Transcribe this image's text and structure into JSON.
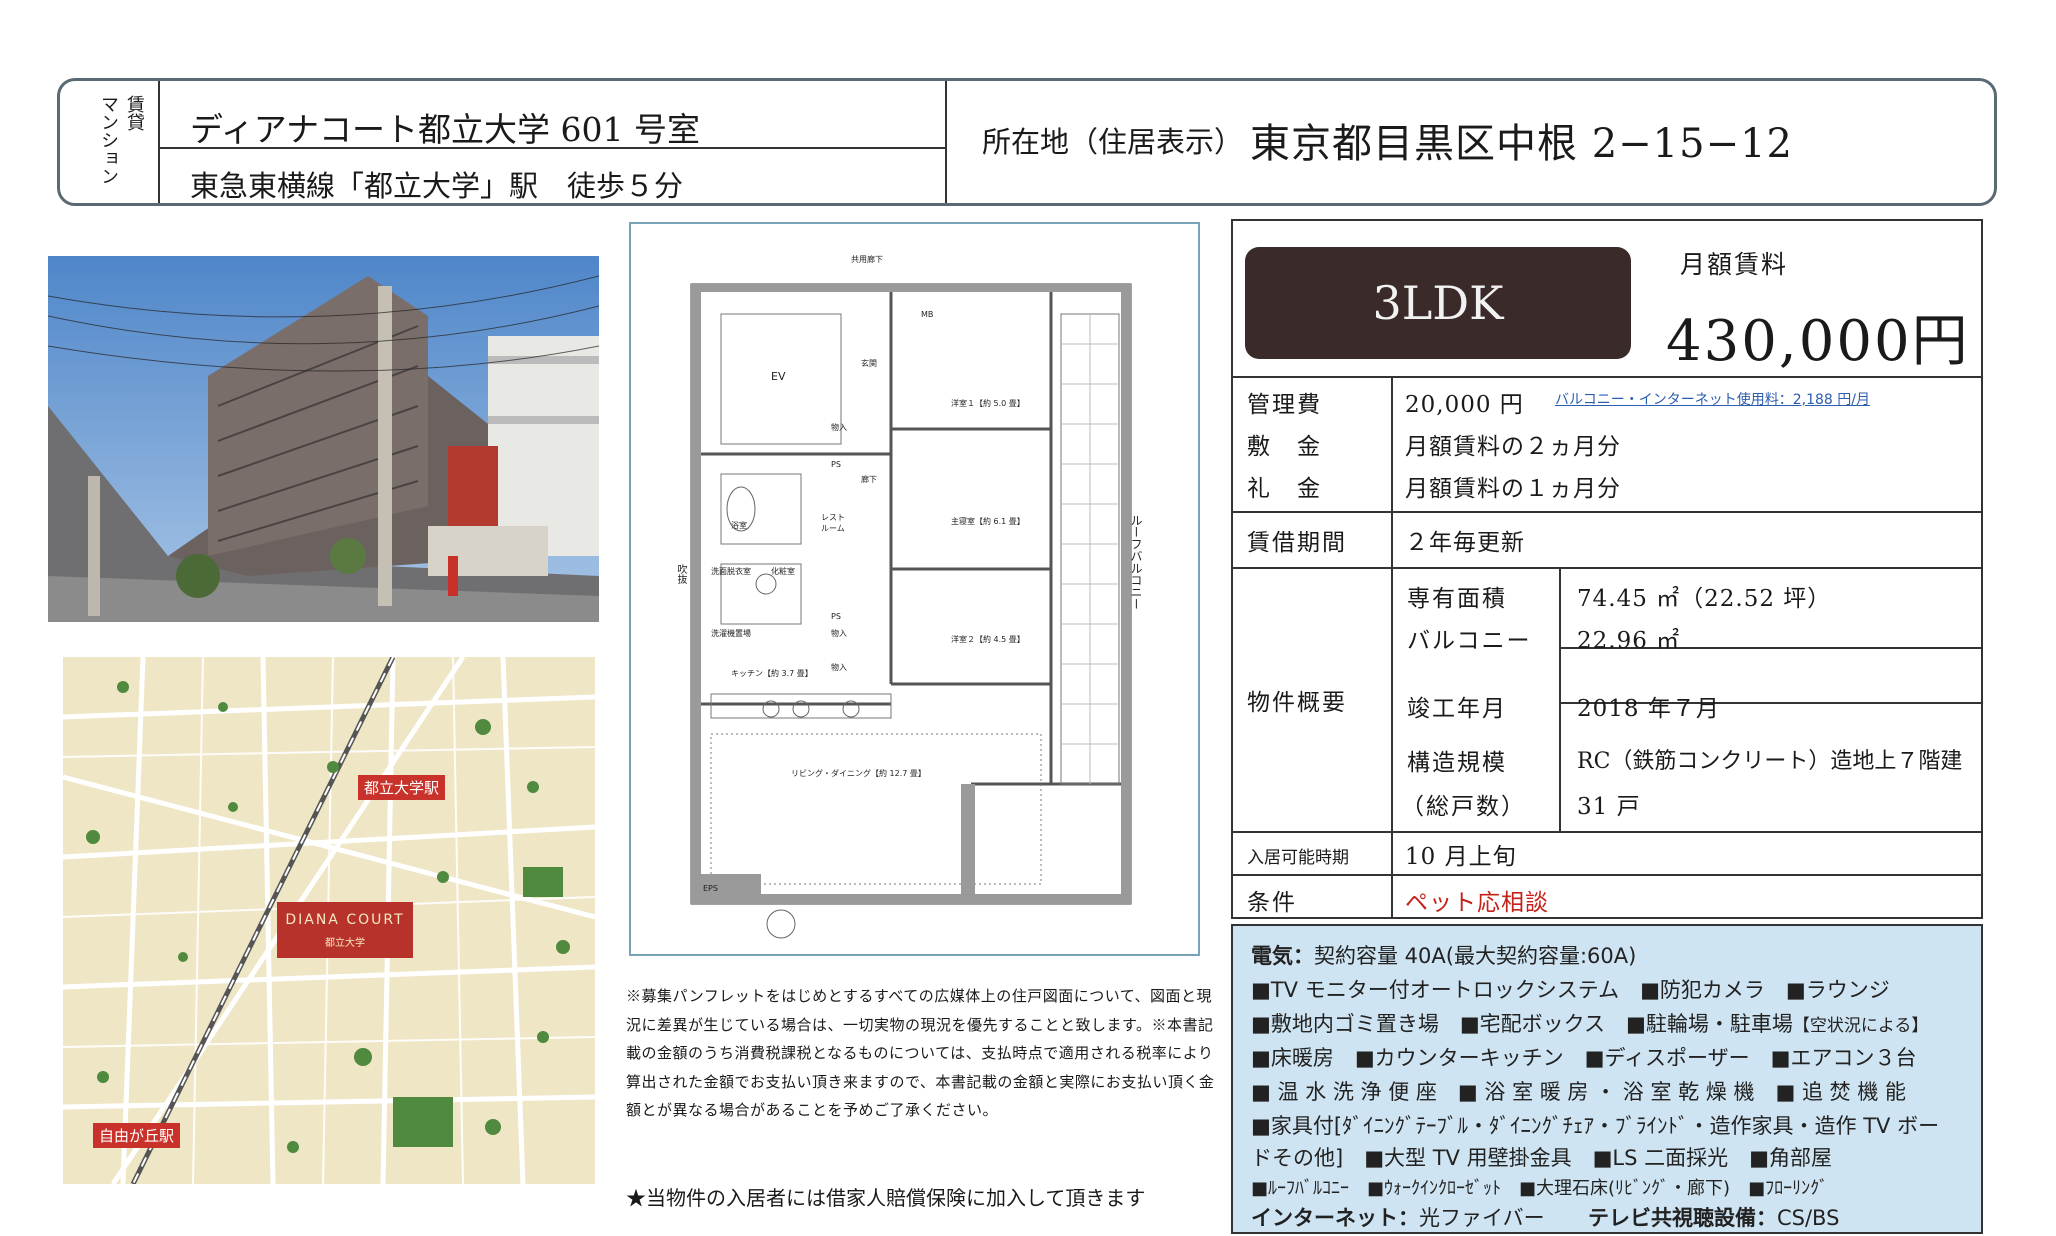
{
  "header": {
    "category": [
      "賃貸",
      "マンション"
    ],
    "building_name": "ディアナコート都立大学 601 号室",
    "access": "東急東横線「都立大学」駅　徒歩５分",
    "address_label": "所在地（住居表示）",
    "address": "東京都目黒区中根 2−15−12"
  },
  "map": {
    "station_top": "都立大学駅",
    "station_bottom": "自由が丘駅",
    "building_label": "DIANA COURT",
    "building_sublabel": "都立大学"
  },
  "plan": {
    "corridor": "共用廊下",
    "ev": "EV",
    "mb": "MB",
    "ps1": "PS",
    "ps2": "PS",
    "entrance": "玄関",
    "storage1": "物入",
    "hall": "廊下",
    "restroom": "レスト\nルーム",
    "bath": "浴室",
    "washroom": "洗面脱衣室",
    "powder": "化粧室",
    "laundry": "洗濯機置場",
    "storage2": "物入",
    "storage3": "物入",
    "western1": "洋室１【約 5.0 畳】",
    "main_bedroom": "主寝室【約 6.1 畳】",
    "western2": "洋室２【約 4.5 畳】",
    "kitchen": "キッチン【約 3.7 畳】",
    "living": "リビング・ダイニング【約 12.7 畳】",
    "roof_balcony": "ルーフバルコニー",
    "void": "吹抜",
    "eps": "EPS"
  },
  "notes": "※募集パンフレットをはじめとするすべての広媒体上の住戸図面について、図面と現況に差異が生じている場合は、一切実物の現況を優先することと致します。※本書記載の金額のうち消費税課税となるものについては、支払時点で適用される税率により算出された金額でお支払い頂き来ますので、本書記載の金額と実際にお支払い頂く金額とが異なる場合があることを予めご了承ください。",
  "insurance": "★当物件の入居者には借家人賠償保険に加入して頂きます",
  "summary": {
    "layout": "3LDK",
    "rent_label": "月額賃料",
    "rent": "430,000円",
    "mgmt_label": "管理費",
    "mgmt_value": "20,000 円",
    "net_note": "バルコニー・インターネット使用料：2,188 円/月",
    "deposit_label": "敷　金",
    "deposit_value": "月額賃料の２ヵ月分",
    "keymoney_label": "礼　金",
    "keymoney_value": "月額賃料の１ヵ月分",
    "lease_label": "賃借期間",
    "lease_value": "２年毎更新",
    "overview_label": "物件概要",
    "area_label": "専有面積",
    "area_value": "74.45 ㎡（22.52 坪）",
    "balcony_label": "バルコニー",
    "balcony_value": "22.96 ㎡",
    "built_label": "竣工年月",
    "built_value": "2018 年７月",
    "structure_label": "構造規模",
    "structure_value": "RC（鉄筋コンクリート）造地上７階建",
    "units_label": "（総戸数）",
    "units_value": "31 戸",
    "movein_label": "入居可能時期",
    "movein_value": "10 月上旬",
    "cond_label": "条件",
    "cond_value": "ペット応相談"
  },
  "amenities": {
    "elec_label": "電気：",
    "elec_value": "契約容量 40A(最大契約容量:60A)",
    "line1": "■TV モニター付オートロックシステム　■防犯カメラ　■ラウンジ",
    "line2a": "■敷地内ゴミ置き場　■宅配ボックス　■駐輪場・駐車場",
    "line2b": "【空状況による】",
    "line3": "■床暖房　■カウンターキッチン　■ディスポーザー　■エアコン３台",
    "line4": "■ 温 水 洗 浄 便 座　■ 浴 室 暖 房 ・ 浴 室 乾 燥 機　■ 追 焚 機 能",
    "line5": "■家具付[ﾀﾞｲﾆﾝｸﾞﾃｰﾌﾞﾙ・ﾀﾞｲﾆﾝｸﾞﾁｪｱ・ﾌﾞﾗｲﾝﾄﾞ・造作家具・造作 TV ボー",
    "line6": "ドその他]　■大型 TV 用壁掛金具　■LS 二面採光　■角部屋",
    "line7": "■ﾙｰﾌﾊﾞﾙｺﾆｰ　■ｳｫｰｸｲﾝｸﾛｰｾﾞｯﾄ　■大理石床(ﾘﾋﾞﾝｸﾞ・廊下)　■ﾌﾛｰﾘﾝｸﾞ",
    "net_label": "インターネット：",
    "net_value": "光ファイバー",
    "tv_label": "テレビ共視聴設備：",
    "tv_value": "CS/BS"
  },
  "colors": {
    "header_border": "#5a6a74",
    "layout_box": "#3a2a2a",
    "condition": "#c4221a",
    "amenities_bg": "#cfe4f2",
    "plan_border": "#7aa2b8",
    "map_station": "#c9322b"
  }
}
